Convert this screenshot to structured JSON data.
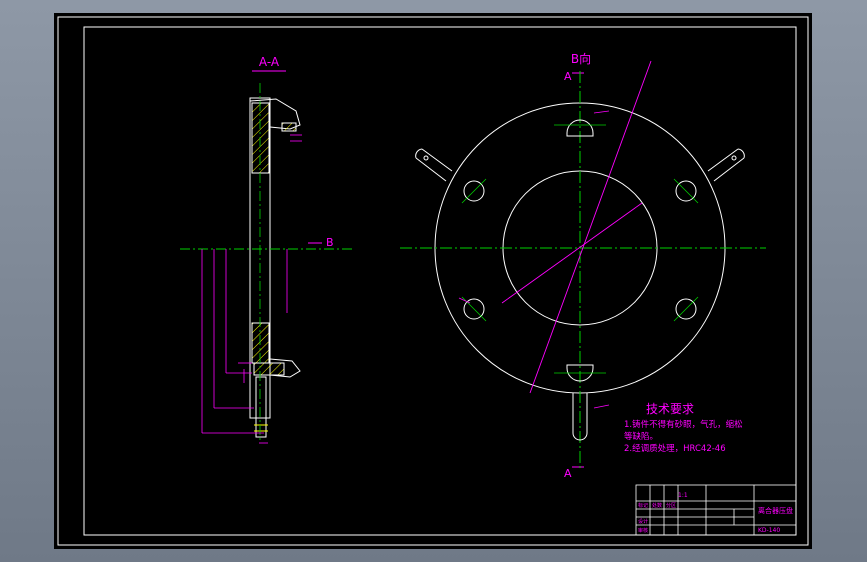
{
  "section_view": {
    "title": "A-A",
    "cut_marker": "B"
  },
  "plan_view": {
    "title": "B向",
    "cut_label_top": "A",
    "cut_label_bottom": "A"
  },
  "notes": {
    "title": "技术要求",
    "line1": "1.铸件不得有砂眼，气孔，缩松",
    "line2": "等缺陷。",
    "line3": "2.经调质处理，HRC42-46"
  },
  "title_block": {
    "part_name": "离合器压盘",
    "drawing_no": "KD-140",
    "scale": "1:1",
    "row_labels": [
      "标记",
      "处数",
      "分区",
      "设计",
      "审核"
    ]
  },
  "colors": {
    "outline": "#ffffff",
    "centerline": "#00d000",
    "dimension": "#ff00ff",
    "hatch": "#ffff00",
    "border": "#ffffff"
  }
}
